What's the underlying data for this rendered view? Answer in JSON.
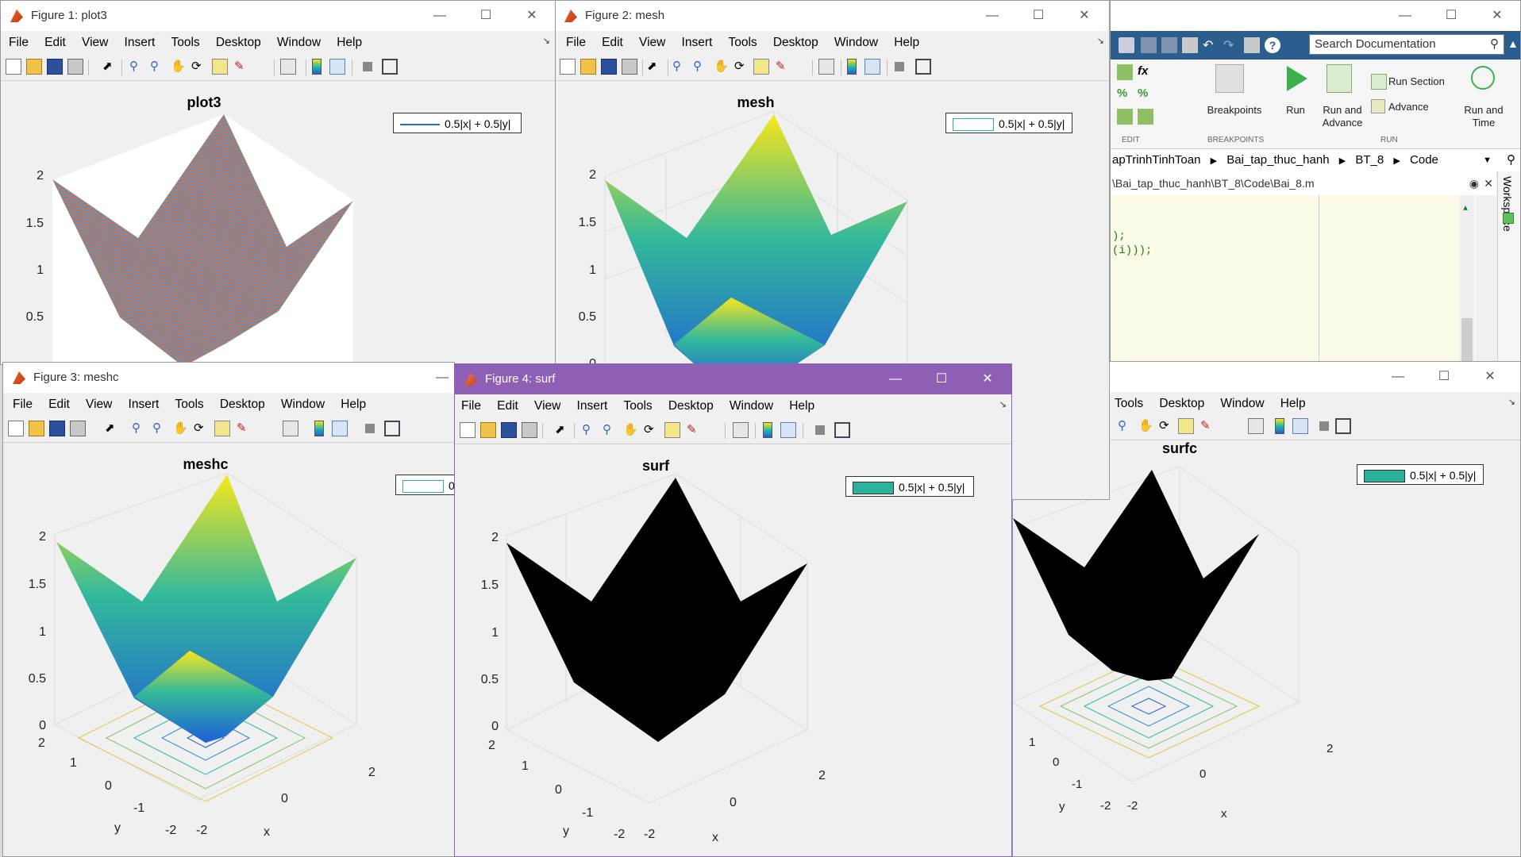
{
  "menus": [
    "File",
    "Edit",
    "View",
    "Insert",
    "Tools",
    "Desktop",
    "Window",
    "Help"
  ],
  "legend_label": "0.5|x| + 0.5|y|",
  "figures": {
    "fig1": {
      "title": "Figure 1: plot3",
      "plot_title": "plot3"
    },
    "fig2": {
      "title": "Figure 2: mesh",
      "plot_title": "mesh"
    },
    "fig3": {
      "title": "Figure 3: meshc",
      "plot_title": "meshc",
      "legend_partial": "0"
    },
    "fig4": {
      "title": "Figure 4: surf",
      "plot_title": "surf"
    },
    "fig5": {
      "plot_title": "surfc",
      "menus_partial": [
        "Tools",
        "Desktop",
        "Window",
        "Help"
      ]
    }
  },
  "axes": {
    "z_ticks": [
      "2",
      "1.5",
      "1",
      "0.5",
      "0"
    ],
    "y_ticks": [
      "2",
      "1",
      "0",
      "-1",
      "-2"
    ],
    "x_ticks": [
      "-2",
      "0",
      "2"
    ],
    "xlabel": "x",
    "ylabel": "y"
  },
  "matlab": {
    "search_placeholder": "Search Documentation",
    "buttons": {
      "breakpoints": "Breakpoints",
      "run": "Run",
      "run_and_advance": "Run and Advance",
      "run_section": "Run Section",
      "advance": "Advance",
      "run_and_time": "Run and Time"
    },
    "sections": {
      "edit": "EDIT",
      "breakpoints": "BREAKPOINTS",
      "run": "RUN"
    },
    "breadcrumb": [
      "apTrinhTinhToan",
      "Bai_tap_thuc_hanh",
      "BT_8",
      "Code"
    ],
    "file_path": "\\Bai_tap_thuc_hanh\\BT_8\\Code\\Bai_8.m",
    "workspace_label": "Workspace",
    "code_lines": [
      ");",
      "(i)));"
    ]
  },
  "chart_data": [
    {
      "type": "surface",
      "title": "plot3",
      "function": "z = 0.5|x| + 0.5|y|",
      "style": "lines",
      "zlim": [
        0,
        2
      ],
      "legend": "0.5|x| + 0.5|y|"
    },
    {
      "type": "surface",
      "title": "mesh",
      "function": "z = 0.5|x| + 0.5|y|",
      "style": "mesh",
      "colormap": "parula",
      "zlim": [
        0,
        2
      ],
      "legend": "0.5|x| + 0.5|y|"
    },
    {
      "type": "surface",
      "title": "meshc",
      "function": "z = 0.5|x| + 0.5|y|",
      "style": "mesh+contour",
      "colormap": "parula",
      "xlim": [
        -2,
        2
      ],
      "ylim": [
        -2,
        2
      ],
      "zlim": [
        0,
        2
      ],
      "xlabel": "x",
      "ylabel": "y"
    },
    {
      "type": "surface",
      "title": "surf",
      "function": "z = 0.5|x| + 0.5|y|",
      "style": "surf",
      "facecolor": "#000000",
      "xlim": [
        -2,
        2
      ],
      "ylim": [
        -2,
        2
      ],
      "zlim": [
        0,
        2
      ],
      "xlabel": "x",
      "ylabel": "y",
      "legend": "0.5|x| + 0.5|y|"
    },
    {
      "type": "surface",
      "title": "surfc",
      "function": "z = 0.5|x| + 0.5|y|",
      "style": "surf+contour",
      "facecolor": "#000000",
      "xlim": [
        -2,
        2
      ],
      "ylim": [
        -2,
        2
      ],
      "zlim": [
        0,
        2
      ],
      "xlabel": "x",
      "ylabel": "y",
      "legend": "0.5|x| + 0.5|y|"
    }
  ],
  "colors": {
    "active_title": "#8e60b5",
    "legend_swatch": "#2ab39a",
    "parula_yellow": "#f9e61b",
    "parula_teal": "#27b8a2",
    "parula_blue": "#1f5fd8"
  }
}
